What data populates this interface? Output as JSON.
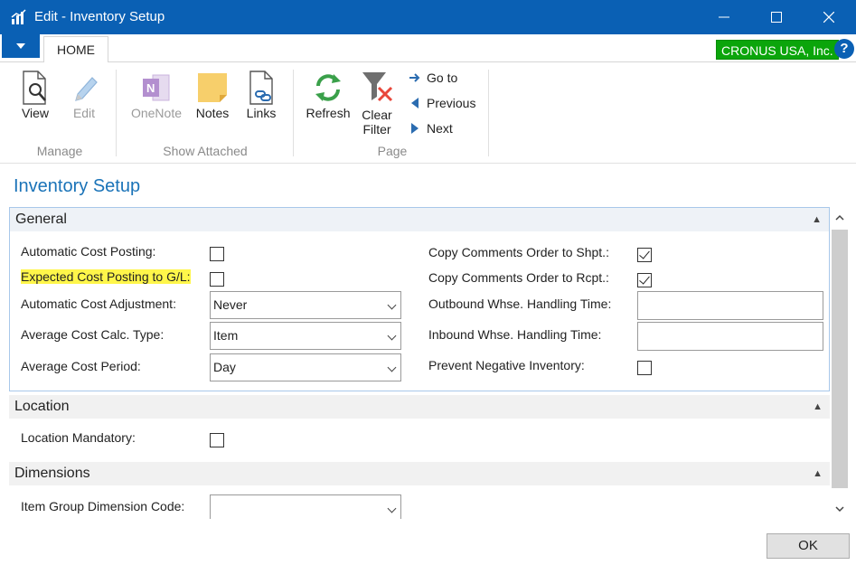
{
  "window": {
    "title": "Edit - Inventory Setup",
    "minimize_glyph": "—",
    "maximize_glyph": "☐",
    "close_glyph": "✕"
  },
  "ribbon_tabs": {
    "home": "HOME",
    "company": "CRONUS USA, Inc.",
    "help": "?"
  },
  "ribbon": {
    "manage": {
      "label": "Manage",
      "view": "View",
      "edit": "Edit"
    },
    "show_attached": {
      "label": "Show Attached",
      "onenote": "OneNote",
      "notes": "Notes",
      "links": "Links"
    },
    "page": {
      "label": "Page",
      "refresh": "Refresh",
      "clear_filter_line1": "Clear",
      "clear_filter_line2": "Filter",
      "go_to": "Go to",
      "previous": "Previous",
      "next": "Next"
    }
  },
  "page_title": "Inventory Setup",
  "general": {
    "header": "General",
    "automatic_cost_posting": {
      "label": "Automatic Cost Posting:",
      "checked": false
    },
    "expected_cost_posting": {
      "label": "Expected Cost Posting to G/L:",
      "checked": false
    },
    "automatic_cost_adjustment": {
      "label": "Automatic Cost Adjustment:",
      "value": "Never"
    },
    "average_cost_calc_type": {
      "label": "Average Cost Calc. Type:",
      "value": "Item"
    },
    "average_cost_period": {
      "label": "Average Cost Period:",
      "value": "Day"
    },
    "copy_comments_shpt": {
      "label": "Copy Comments Order to Shpt.:",
      "checked": true
    },
    "copy_comments_rcpt": {
      "label": "Copy Comments Order to Rcpt.:",
      "checked": true
    },
    "outbound_whse_time": {
      "label": "Outbound Whse. Handling Time:",
      "value": ""
    },
    "inbound_whse_time": {
      "label": "Inbound Whse. Handling Time:",
      "value": ""
    },
    "prevent_negative_inventory": {
      "label": "Prevent Negative Inventory:",
      "checked": false
    }
  },
  "location": {
    "header": "Location",
    "location_mandatory": {
      "label": "Location Mandatory:",
      "checked": false
    }
  },
  "dimensions": {
    "header": "Dimensions",
    "item_group_dimension_code": {
      "label": "Item Group Dimension Code:",
      "value": ""
    }
  },
  "footer": {
    "ok": "OK"
  },
  "colors": {
    "title_bar": "#0a60b4",
    "company_badge": "#0ba50b",
    "page_title": "#1a73b8",
    "highlight": "#fff64a"
  }
}
